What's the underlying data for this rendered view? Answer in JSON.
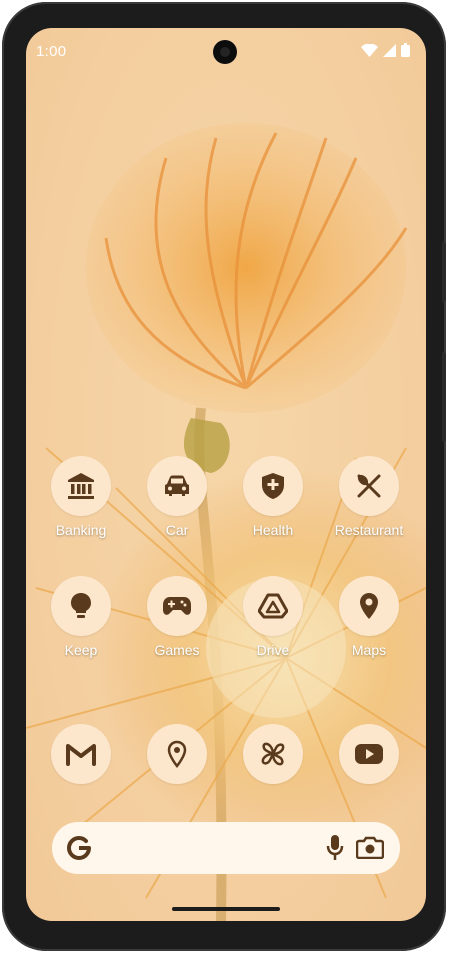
{
  "status_bar": {
    "time": "1:00"
  },
  "apps": [
    {
      "label": "Banking",
      "icon": "bank-icon"
    },
    {
      "label": "Car",
      "icon": "car-icon"
    },
    {
      "label": "Health",
      "icon": "health-shield-icon"
    },
    {
      "label": "Restaurant",
      "icon": "fork-knife-icon"
    },
    {
      "label": "Keep",
      "icon": "lightbulb-icon"
    },
    {
      "label": "Games",
      "icon": "gamepad-icon"
    },
    {
      "label": "Drive",
      "icon": "drive-icon"
    },
    {
      "label": "Maps",
      "icon": "map-pin-icon"
    }
  ],
  "dock": [
    {
      "icon": "gmail-icon"
    },
    {
      "icon": "location-icon"
    },
    {
      "icon": "pinwheel-icon"
    },
    {
      "icon": "youtube-icon"
    }
  ],
  "search_bar": {
    "left_icon": "google-g-icon",
    "mic_icon": "mic-icon",
    "lens_icon": "lens-icon"
  },
  "colors": {
    "wallpaper": "#f4cfa0",
    "icon_bg": "#fde7cc",
    "glyph": "#5a3a1c",
    "accent": "#e5a24a"
  }
}
